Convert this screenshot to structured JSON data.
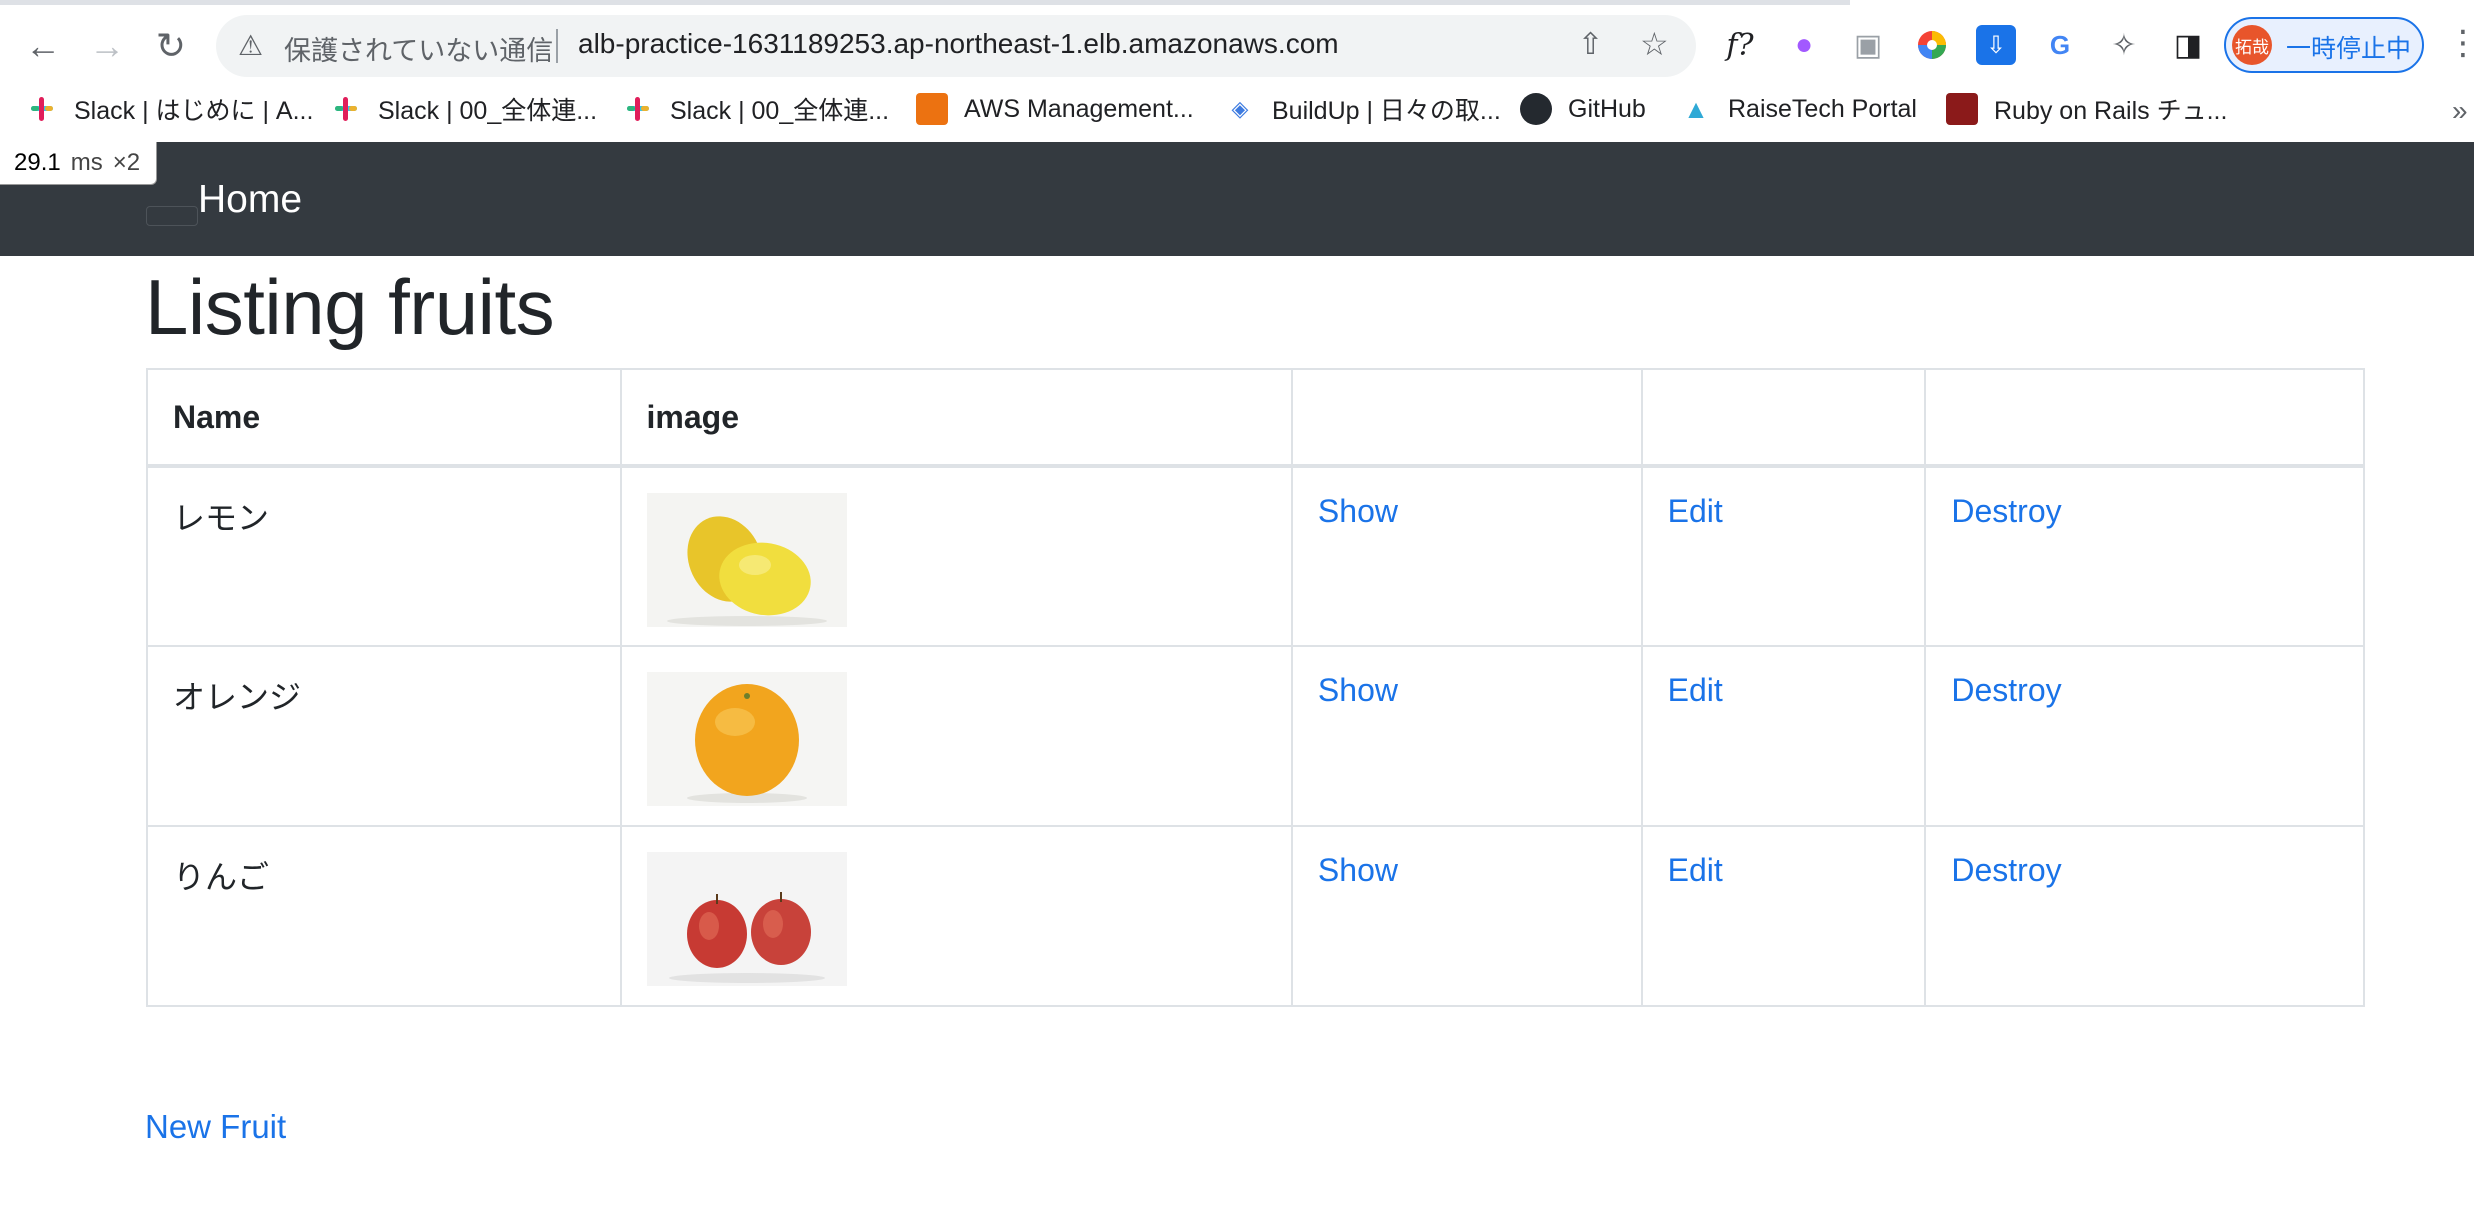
{
  "browser": {
    "security_label": "保護されていない通信",
    "url": "alb-practice-1631189253.ap-northeast-1.elb.amazonaws.com",
    "extensions": [
      "f?"
    ],
    "profile_avatar_text": "拓哉",
    "profile_label": "一時停止中"
  },
  "bookmarks": [
    {
      "label": "Slack | はじめに | A...",
      "icon": "slack-icon"
    },
    {
      "label": "Slack | 00_全体連...",
      "icon": "slack-icon"
    },
    {
      "label": "Slack | 00_全体連...",
      "icon": "slack-icon"
    },
    {
      "label": "AWS Management...",
      "icon": "aws-cube-icon"
    },
    {
      "label": "BuildUp | 日々の取...",
      "icon": "buildup-icon"
    },
    {
      "label": "GitHub",
      "icon": "github-icon"
    },
    {
      "label": "RaiseTech Portal",
      "icon": "raisetech-icon"
    },
    {
      "label": "Ruby on Rails チュ...",
      "icon": "rails-icon"
    }
  ],
  "perf_overlay": {
    "value": "29.1",
    "unit": "ms",
    "multiplier": "×2"
  },
  "navbar": {
    "home_label": "Home"
  },
  "page": {
    "title": "Listing fruits",
    "new_link": "New Fruit"
  },
  "table": {
    "headers": [
      "Name",
      "image",
      "",
      "",
      ""
    ],
    "rows": [
      {
        "name": "レモン",
        "image": "lemon-image",
        "show": "Show",
        "edit": "Edit",
        "destroy": "Destroy"
      },
      {
        "name": "オレンジ",
        "image": "orange-image",
        "show": "Show",
        "edit": "Edit",
        "destroy": "Destroy"
      },
      {
        "name": "りんご",
        "image": "apple-image",
        "show": "Show",
        "edit": "Edit",
        "destroy": "Destroy"
      }
    ]
  },
  "colors": {
    "navbar_bg": "#343a40",
    "link": "#1a73e8",
    "profile_avatar": "#e8552b"
  }
}
